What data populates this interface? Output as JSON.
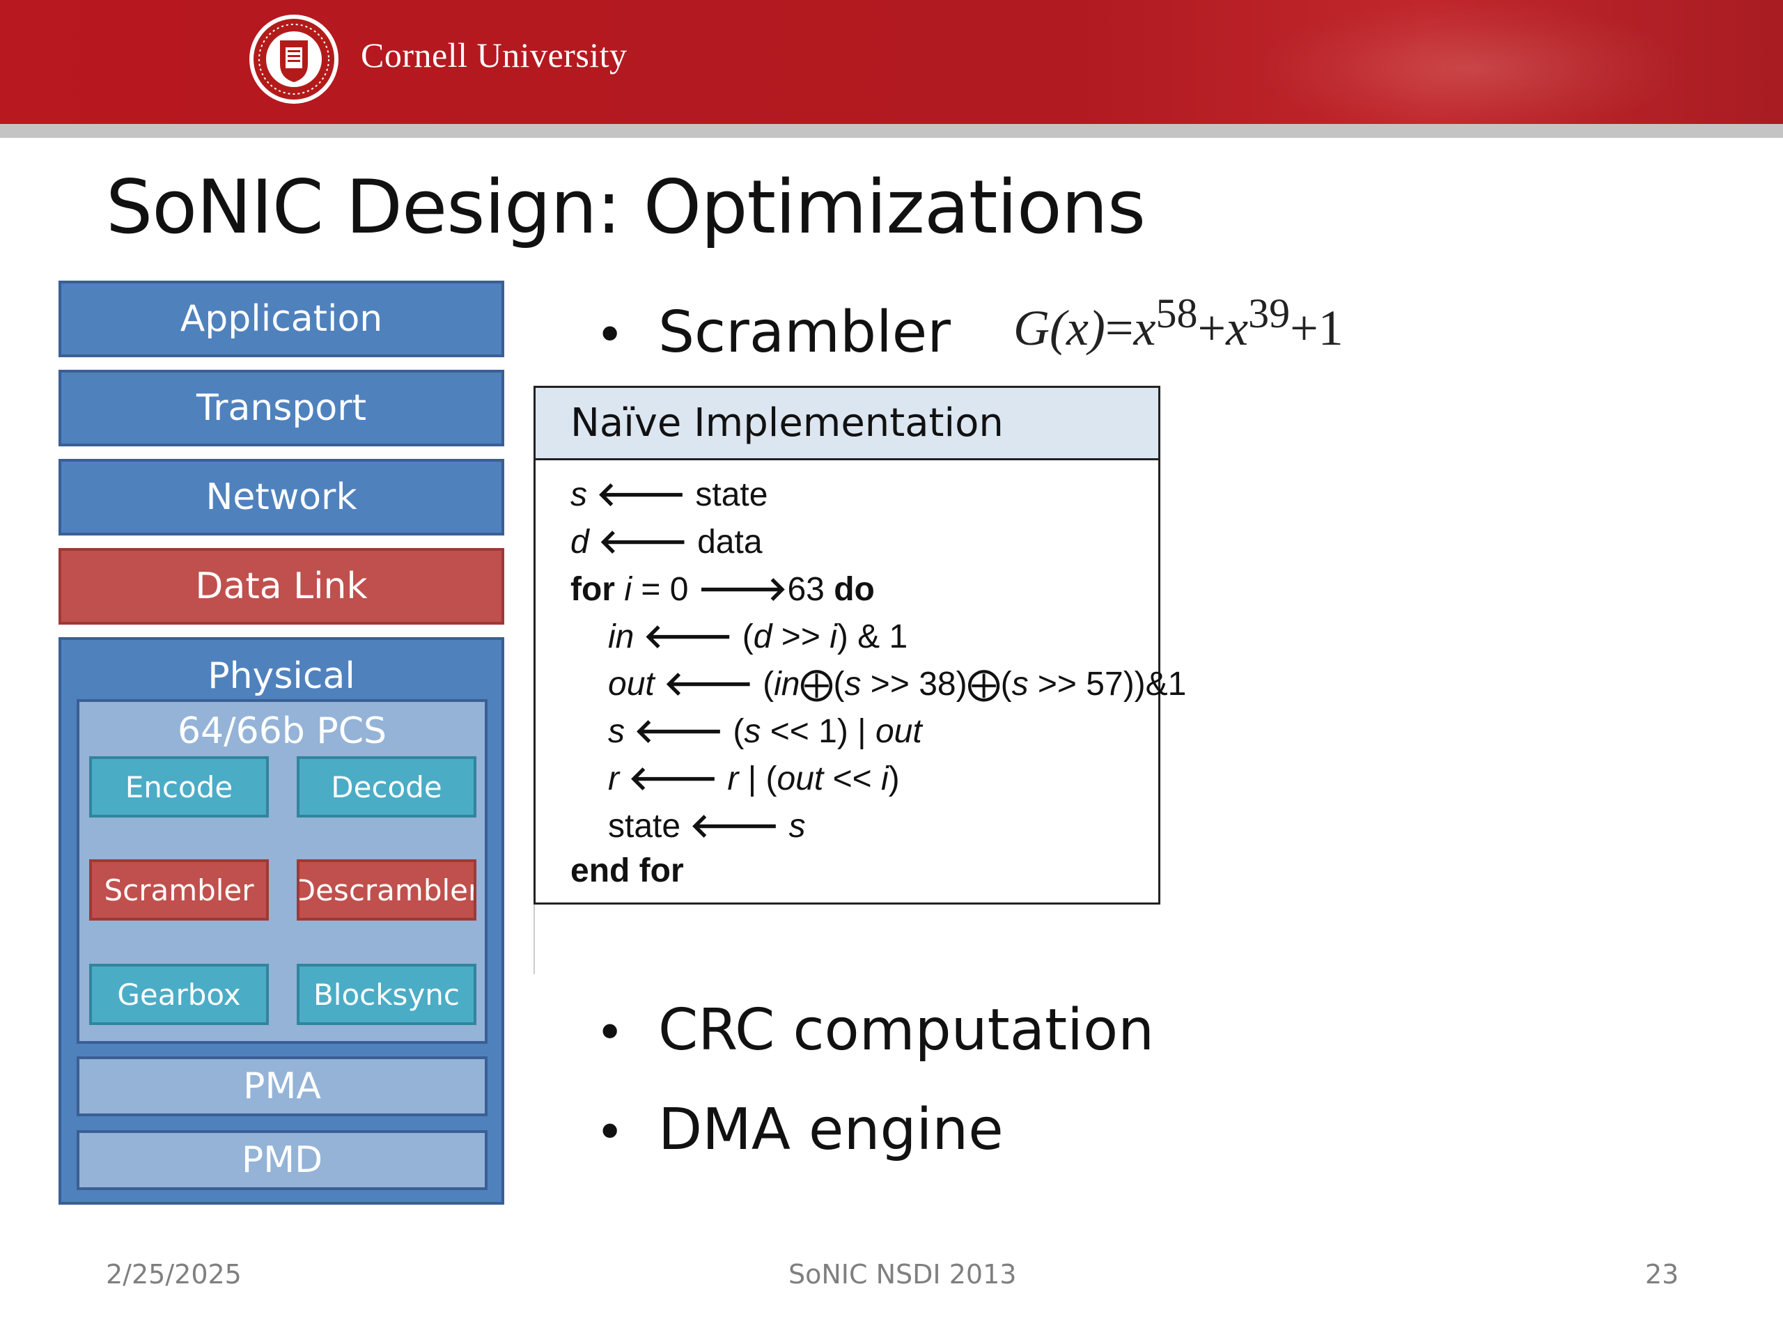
{
  "header": {
    "brand": "Cornell University",
    "seal_text": "CORNELL UNIVERSITY · FOUNDED A.D. 1865",
    "banner_color": "#b01a20"
  },
  "slide": {
    "title": "SoNIC Design: Optimizations",
    "stack": {
      "application": "Application",
      "transport": "Transport",
      "network": "Network",
      "datalink": "Data Link",
      "physical": "Physical",
      "pcs": "64/66b PCS",
      "encode": "Encode",
      "decode": "Decode",
      "scrambler": "Scrambler",
      "descrambler": "Descrambler",
      "gearbox": "Gearbox",
      "blocksync": "Blocksync",
      "pma": "PMA",
      "pmd": "PMD"
    },
    "bullets": {
      "scrambler": "Scrambler",
      "crc": "CRC computation",
      "dma": "DMA engine"
    },
    "formula": {
      "lhs": "G(x)",
      "eq": "=",
      "x": "x",
      "exp1": "58",
      "plus1": "+",
      "exp2": "39",
      "tail": "+1"
    },
    "code": {
      "header": "Naïve Implementation",
      "line1": {
        "var": "s",
        "arrow": "🡐",
        "rest": " state"
      },
      "line2": {
        "var": "d",
        "arrow": "🡐",
        "rest": " data"
      },
      "line3": {
        "kw1": "for",
        "var": "i",
        "mid": " = 0 ",
        "arrow": "🡒",
        "num": "63 ",
        "kw2": "do"
      },
      "line4": {
        "var": "in",
        "arrow": "🡐",
        "p1": " (",
        "d": "d",
        "p2": " >> ",
        "i": "i",
        "p3": ") & 1"
      },
      "line5": {
        "var": "out",
        "arrow": "🡐",
        "p1": " (",
        "in": "in",
        "x1": "⨁",
        "p2": "(",
        "s1": "s",
        "p3": " >> 38)",
        "x2": "⨁",
        "p4": "(",
        "s2": "s",
        "p5": " >> 57))&1"
      },
      "line6": {
        "var": "s",
        "arrow": "🡐",
        "p1": " (",
        "s": "s",
        "p2": " << 1) | ",
        "out": "out"
      },
      "line7": {
        "var": "r",
        "arrow": "🡐",
        "r": " r",
        "p1": " | (",
        "out": "out",
        "p2": " << ",
        "i": "i",
        "p3": ")"
      },
      "line8": {
        "state": "state ",
        "arrow": "🡐",
        "s": " s"
      },
      "line9": "end for"
    },
    "bullet_symbol": "•"
  },
  "footer": {
    "date": "2/25/2025",
    "center": "SoNIC NSDI 2013",
    "page": "23"
  }
}
